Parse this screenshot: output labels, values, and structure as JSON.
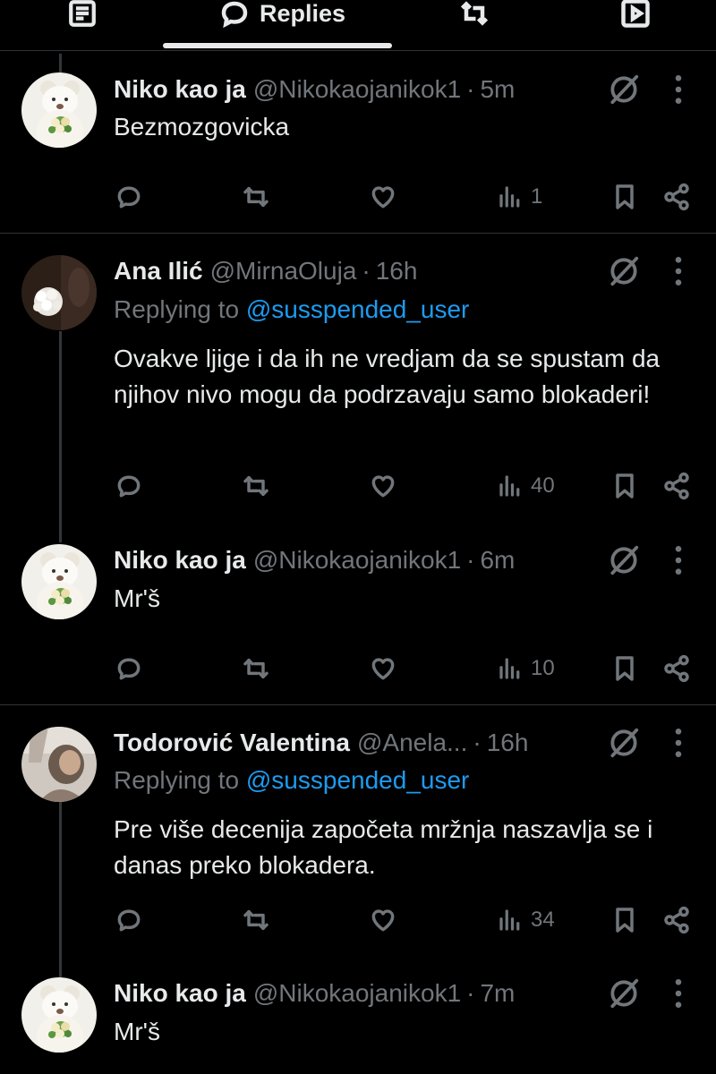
{
  "tabs": {
    "replies_label": "Replies"
  },
  "posts": [
    {
      "name": "Niko kao ja",
      "handle": "@Nikokaojanikok1",
      "sep": "·",
      "time": "5m",
      "text": "Bezmozgovicka",
      "views": "1"
    },
    {
      "name": "Ana Ilić",
      "handle": "@MirnaOluja",
      "sep": "·",
      "time": "16h",
      "replying_prefix": "Replying to ",
      "replying_to": "@susspended_user",
      "text": "Ovakve ljige i da ih ne vredjam da se spustam da njihov nivo mogu da podrzavaju samo blokaderi!",
      "views": "40"
    },
    {
      "name": "Niko kao ja",
      "handle": "@Nikokaojanikok1",
      "sep": "·",
      "time": "6m",
      "text": "Mr'š",
      "views": "10"
    },
    {
      "name": "Todorović Valentina",
      "handle": "@Anela...",
      "sep": "·",
      "time": "16h",
      "replying_prefix": "Replying to ",
      "replying_to": "@susspended_user",
      "text": "Pre više decenija započeta mržnja naszavlja se i danas preko blokadera.",
      "views": "34"
    },
    {
      "name": "Niko kao ja",
      "handle": "@Nikokaojanikok1",
      "sep": "·",
      "time": "7m",
      "text": "Mr'š"
    }
  ],
  "colors": {
    "background": "#000000",
    "text": "#e7e9ea",
    "muted": "#71767b",
    "link": "#1d9bf0",
    "separator": "#2f3336"
  },
  "icons": [
    "reply-icon",
    "repost-icon",
    "like-icon",
    "views-icon",
    "bookmark-icon",
    "share-icon",
    "grok-icon",
    "more-icon"
  ]
}
